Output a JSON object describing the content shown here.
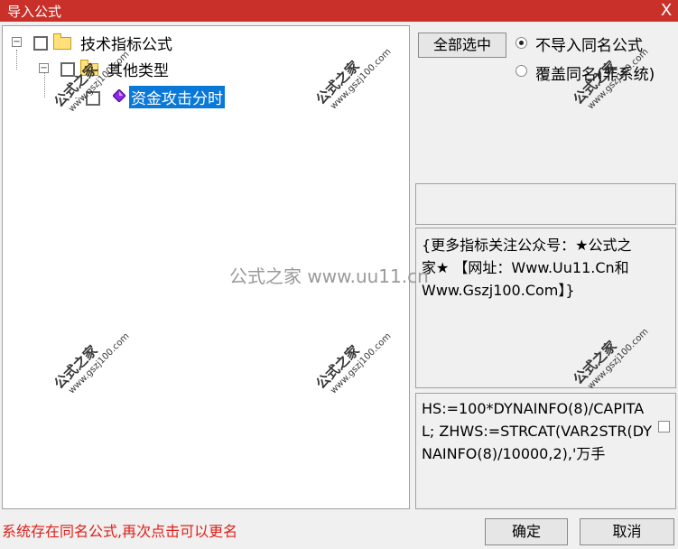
{
  "window": {
    "title": "导入公式",
    "close_glyph": "X"
  },
  "tree": {
    "root": {
      "label": "技术指标公式"
    },
    "child": {
      "label": "其他类型"
    },
    "leaf": {
      "label": "资金攻击分时"
    }
  },
  "controls": {
    "select_all_label": "全部选中",
    "radio_options": [
      {
        "label": "不导入同名公式",
        "selected": true
      },
      {
        "label": "覆盖同名(非系统)",
        "selected": false
      }
    ]
  },
  "description": "{更多指标关注公众号：★公式之家★ 【网址：Www.Uu11.Cn和Www.Gszj100.Com】}",
  "code_preview": "HS:=100*DYNAINFO(8)/CAPITAL; ZHWS:=STRCAT(VAR2STR(DYNAINFO(8)/10000,2),'万手",
  "status_message": "系统存在同名公式,再次点击可以更名",
  "buttons": {
    "ok_label": "确定",
    "cancel_label": "取消"
  },
  "watermark": {
    "brand": "公式之家",
    "url": "www.gszj100.com",
    "center": "公式之家 www.uu11.cn"
  },
  "colors": {
    "title_bar": "#c9302a",
    "selection": "#0a78d7",
    "status": "#e0201a"
  }
}
